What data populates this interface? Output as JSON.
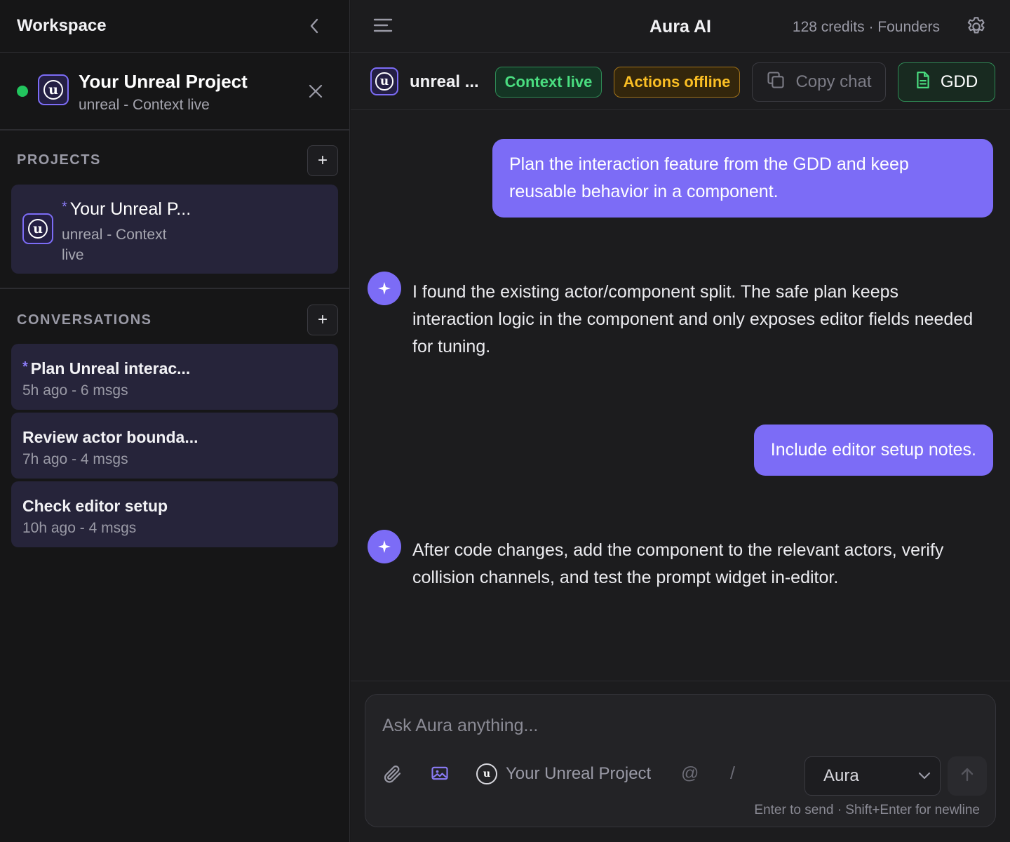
{
  "sidebar": {
    "title": "Workspace",
    "active_project": {
      "name": "Your Unreal Project",
      "subtitle": "unreal - Context live",
      "status_color": "#22c55e"
    },
    "projects_heading": "PROJECTS",
    "projects": [
      {
        "marker": "*",
        "name": "Your Unreal P...",
        "subtitle": "unreal - Context live"
      }
    ],
    "conversations_heading": "CONVERSATIONS",
    "conversations": [
      {
        "marker": "*",
        "title": "Plan Unreal interac...",
        "meta": "5h ago - 6 msgs"
      },
      {
        "marker": "",
        "title": "Review actor bounda...",
        "meta": "7h ago - 4 msgs"
      },
      {
        "marker": "",
        "title": "Check editor setup",
        "meta": "10h ago - 4 msgs"
      }
    ],
    "add_label": "+"
  },
  "header": {
    "title": "Aura AI",
    "credits": "128 credits · Founders"
  },
  "context_bar": {
    "project_name": "unreal ...",
    "badge_live": "Context live",
    "badge_offline": "Actions offline",
    "copy_label": "Copy chat",
    "gdd_label": "GDD"
  },
  "messages": [
    {
      "role": "user",
      "text": "Plan the interaction feature from the GDD and keep reusable behavior in a component."
    },
    {
      "role": "assistant",
      "text": "I found the existing actor/component split. The safe plan keeps interaction logic in the component and only exposes editor fields needed for tuning."
    },
    {
      "role": "user",
      "text": "Include editor setup notes."
    },
    {
      "role": "assistant",
      "text": "After code changes, add the component to the relevant actors, verify collision channels, and test the prompt widget in-editor."
    }
  ],
  "composer": {
    "placeholder": "Ask Aura anything...",
    "project_chip": "Your Unreal Project",
    "mention": "@",
    "command": "/",
    "model": "Aura",
    "hint": "Enter to send · Shift+Enter for newline"
  },
  "colors": {
    "accent": "#7c6cf6",
    "live": "#4ade80",
    "offline": "#fbbf24"
  },
  "icons": {
    "collapse": "chevron-left-icon",
    "close": "close-icon",
    "menu": "menu-icon",
    "settings": "gear-icon",
    "copy": "copy-icon",
    "document": "document-icon",
    "assistant": "sparkle-icon",
    "attach": "paperclip-icon",
    "image": "image-icon",
    "send": "arrow-up-icon",
    "dropdown": "chevron-down-icon"
  }
}
